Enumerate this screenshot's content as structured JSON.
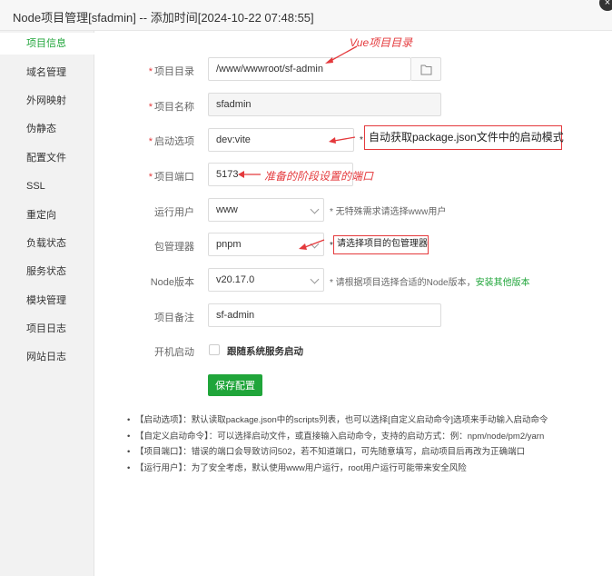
{
  "window": {
    "title": "Node项目管理[sfadmin] -- 添加时间[2024-10-22 07:48:55]",
    "close_glyph": "×"
  },
  "sidebar": {
    "items": [
      {
        "label": "项目信息",
        "active": true
      },
      {
        "label": "域名管理"
      },
      {
        "label": "外网映射"
      },
      {
        "label": "伪静态"
      },
      {
        "label": "配置文件"
      },
      {
        "label": "SSL"
      },
      {
        "label": "重定向"
      },
      {
        "label": "负载状态"
      },
      {
        "label": "服务状态"
      },
      {
        "label": "模块管理"
      },
      {
        "label": "项目日志"
      },
      {
        "label": "网站日志"
      }
    ]
  },
  "form": {
    "required_mark": "*",
    "project_dir": {
      "label": "项目目录",
      "value": "/www/wwwroot/sf-admin"
    },
    "project_name": {
      "label": "项目名称",
      "value": "sfadmin"
    },
    "start_option": {
      "label": "启动选项",
      "value": "dev:vite"
    },
    "project_port": {
      "label": "项目端口",
      "value": "5173"
    },
    "run_user": {
      "label": "运行用户",
      "value": "www",
      "hint": "* 无特殊需求请选择www用户"
    },
    "package_manager": {
      "label": "包管理器",
      "value": "pnpm"
    },
    "node_version": {
      "label": "Node版本",
      "value": "v20.17.0",
      "hint": "* 请根据项目选择合适的Node版本，",
      "hint_link": "安装其他版本"
    },
    "remark": {
      "label": "项目备注",
      "value": "sf-admin"
    },
    "autostart": {
      "label": "开机启动",
      "checkbox_label": "跟随系统服务启动",
      "checked": false
    },
    "save_label": "保存配置"
  },
  "annotations": {
    "vue_dir": "Vue项目目录",
    "start_mode": "自动获取package.json文件中的启动模式",
    "start_mode_prefix": "*",
    "port_note": "准备的阶段设置的端口",
    "pm_note": "请选择项目的包管理器",
    "pm_note_prefix": "*"
  },
  "notes": [
    "【启动选项】：默认读取package.json中的scripts列表，也可以选择[自定义启动命令]选项来手动输入启动命令",
    "【自定义启动命令】：可以选择启动文件，或直接输入启动命令，支持的启动方式：例：npm/node/pm2/yarn",
    "【项目端口】：错误的端口会导致访问502，若不知道端口，可先随意填写，启动项目后再改为正确端口",
    "【运行用户】：为了安全考虑，默认使用www用户运行，root用户运行可能带来安全风险"
  ],
  "colors": {
    "accent": "#20a53a",
    "annotation": "#e4393c",
    "sidebar_bg": "#f2f2f2"
  },
  "icons": {
    "folder": "folder-icon",
    "close": "close-icon",
    "dropdown": "chevron-down-icon",
    "arrow": "arrow-left-icon"
  }
}
